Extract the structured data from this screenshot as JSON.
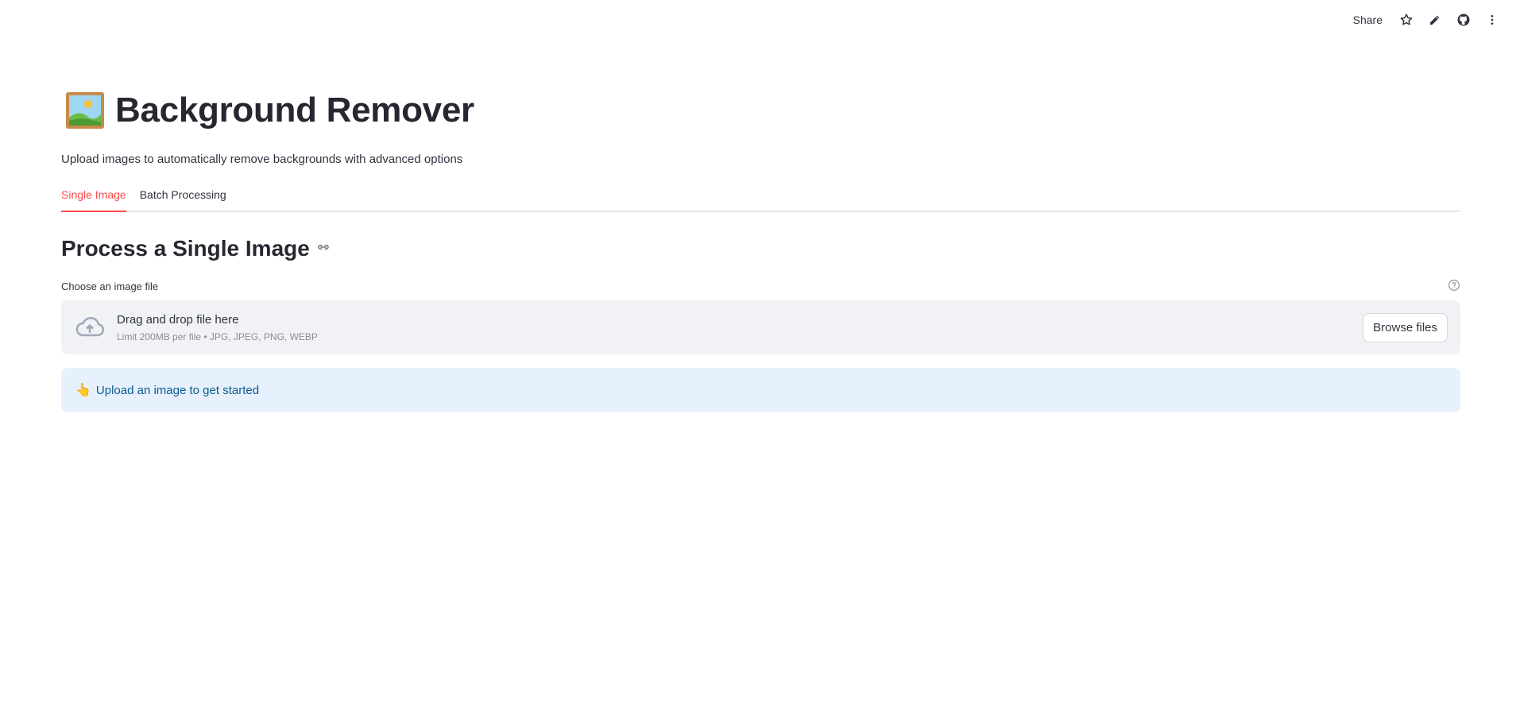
{
  "toolbar": {
    "share_label": "Share",
    "icons": [
      "star-icon",
      "pencil-icon",
      "github-icon",
      "more-vertical-icon"
    ]
  },
  "header": {
    "emoji_icon": "framed-picture-icon",
    "title": "Background Remover",
    "subtitle": "Upload images to automatically remove backgrounds with advanced options"
  },
  "tabs": [
    {
      "label": "Single Image",
      "active": true
    },
    {
      "label": "Batch Processing",
      "active": false
    }
  ],
  "section": {
    "title": "Process a Single Image",
    "anchor_icon": "link-icon"
  },
  "uploader": {
    "label": "Choose an image file",
    "help_icon": "help-circle-icon",
    "drop_text": "Drag and drop file here",
    "limit_text": "Limit 200MB per file • JPG, JPEG, PNG, WEBP",
    "browse_label": "Browse files",
    "cloud_icon": "cloud-upload-icon"
  },
  "info": {
    "icon": "👆",
    "text": "Upload an image to get started"
  },
  "colors": {
    "accent": "#ff4b4b",
    "info_bg": "#e6f1fd",
    "info_text": "#0b5a8c",
    "dropzone_bg": "#f0f2f6"
  }
}
